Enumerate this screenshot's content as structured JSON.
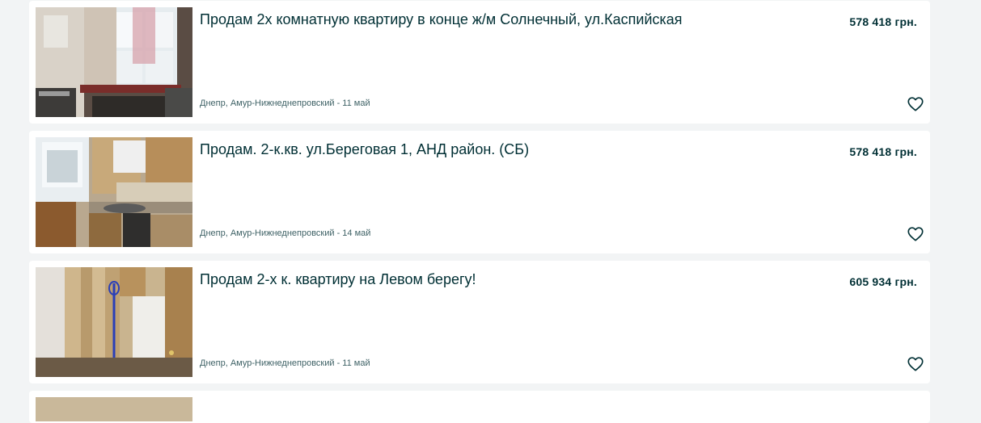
{
  "listings": [
    {
      "title": "Продам 2х комнатную квартиру в конце ж/м Солнечный, ул.Каспийская",
      "price": "578 418 грн.",
      "location_date": "Днепр, Амур-Нижнеднепровский - 11 май",
      "favorite_icon": "heart-outline-icon"
    },
    {
      "title": "Продам. 2-к.кв. ул.Береговая 1, АНД район. (СБ)",
      "price": "578 418 грн.",
      "location_date": "Днепр, Амур-Нижнеднепровский - 14 май",
      "favorite_icon": "heart-outline-icon"
    },
    {
      "title": "Продам 2-х к. квартиру на Левом берегу!",
      "price": "605 934 грн.",
      "location_date": "Днепр, Амур-Нижнеднепровский - 11 май",
      "favorite_icon": "heart-outline-icon"
    }
  ],
  "colors": {
    "page_background": "#f2f4f5",
    "card_background": "#ffffff",
    "title_text": "#002f34",
    "meta_text": "#406367"
  }
}
